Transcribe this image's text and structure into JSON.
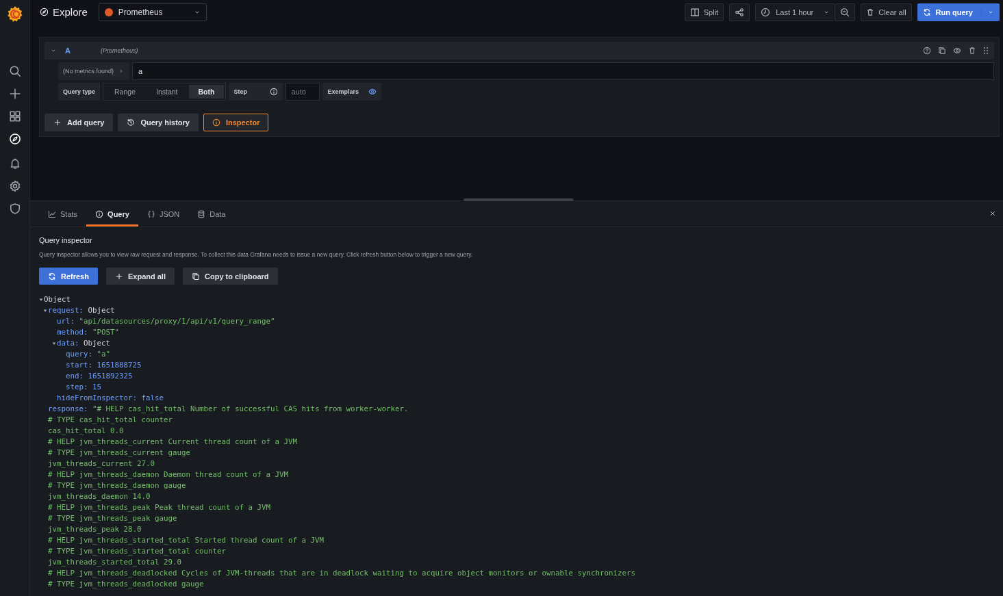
{
  "topbar": {
    "title": "Explore",
    "datasource": "Prometheus",
    "buttons": [
      {
        "label": "Split",
        "kind": "split"
      },
      {
        "kind": "share"
      }
    ],
    "time_range": "Last 1 hour",
    "clear": "Clear all",
    "run": "Run query"
  },
  "query": {
    "ref": "A",
    "datasource": "(Prometheus)",
    "metrics": "(No metrics found)",
    "value": "a",
    "query_type_label": "Query type",
    "query_types": [
      {
        "label": "Range",
        "selected": false
      },
      {
        "label": "Instant",
        "selected": false
      },
      {
        "label": "Both",
        "selected": true
      }
    ],
    "step_label": "Step",
    "step_placeholder": "auto",
    "exemplars_label": "Exemplars",
    "exemplars_on": true
  },
  "actions": [
    {
      "label": "Add query",
      "kind": "add",
      "active": false
    },
    {
      "label": "Query history",
      "kind": "history",
      "active": false
    },
    {
      "label": "Inspector",
      "kind": "info",
      "active": true
    }
  ],
  "inspector": {
    "tabs": [
      {
        "label": "Stats",
        "kind": "stats",
        "selected": false
      },
      {
        "label": "Query",
        "kind": "info",
        "selected": true
      },
      {
        "label": "JSON",
        "kind": "json",
        "selected": false
      },
      {
        "label": "Data",
        "kind": "data",
        "selected": false
      }
    ],
    "heading": "Query inspector",
    "description": "Query inspector allows you to view raw request and response. To collect this data Grafana needs to issue a new query. Click refresh button below to trigger a new query.",
    "buttons": [
      {
        "label": "Refresh",
        "kind": "refresh",
        "primary": true
      },
      {
        "label": "Expand all",
        "kind": "add",
        "primary": false
      },
      {
        "label": "Copy to clipboard",
        "kind": "copy",
        "primary": false
      }
    ],
    "tree": {
      "value": "Object",
      "kind": "object",
      "expanded": true,
      "children": [
        {
          "key": "request:",
          "value": "Object",
          "kind": "object",
          "expanded": true,
          "children": [
            {
              "key": "url:",
              "value": "\"api/datasources/proxy/1/api/v1/query_range\"",
              "kind": "string"
            },
            {
              "key": "method:",
              "value": "\"POST\"",
              "kind": "string"
            },
            {
              "key": "data:",
              "value": "Object",
              "kind": "object",
              "expanded": true,
              "children": [
                {
                  "key": "query:",
                  "value": "\"a\"",
                  "kind": "string"
                },
                {
                  "key": "start:",
                  "value": "1651888725",
                  "kind": "number"
                },
                {
                  "key": "end:",
                  "value": "1651892325",
                  "kind": "number"
                },
                {
                  "key": "step:",
                  "value": "15",
                  "kind": "number"
                }
              ]
            },
            {
              "key": "hideFromInspector:",
              "value": "false",
              "kind": "number"
            }
          ]
        },
        {
          "key": "response:",
          "kind": "text",
          "lines": [
            "\"# HELP cas_hit_total Number of successful CAS hits from worker-worker.",
            "# TYPE cas_hit_total counter",
            "cas_hit_total 0.0",
            "# HELP jvm_threads_current Current thread count of a JVM",
            "# TYPE jvm_threads_current gauge",
            "jvm_threads_current 27.0",
            "# HELP jvm_threads_daemon Daemon thread count of a JVM",
            "# TYPE jvm_threads_daemon gauge",
            "jvm_threads_daemon 14.0",
            "# HELP jvm_threads_peak Peak thread count of a JVM",
            "# TYPE jvm_threads_peak gauge",
            "jvm_threads_peak 28.0",
            "# HELP jvm_threads_started_total Started thread count of a JVM",
            "# TYPE jvm_threads_started_total counter",
            "jvm_threads_started_total 29.0",
            "# HELP jvm_threads_deadlocked Cycles of JVM-threads that are in deadlock waiting to acquire object monitors or ownable synchronizers",
            "# TYPE jvm_threads_deadlocked gauge"
          ]
        }
      ]
    }
  }
}
